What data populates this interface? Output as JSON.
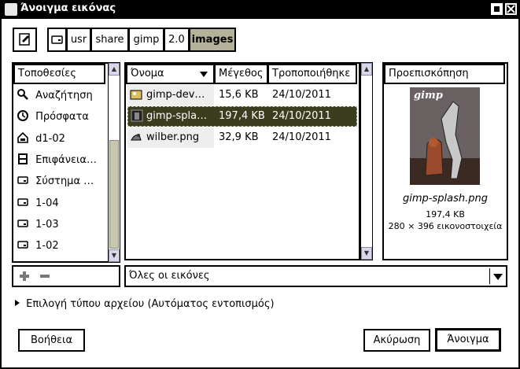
{
  "window": {
    "title": "Άνοιγμα εικόνας"
  },
  "pathbar": {
    "buttons": [
      "usr",
      "share",
      "gimp",
      "2.0",
      "images"
    ],
    "active": "images"
  },
  "places": {
    "header": "Τοποθεσίες",
    "items": [
      {
        "label": "Αναζήτηση",
        "icon": "search-icon"
      },
      {
        "label": "Πρόσφατα",
        "icon": "clock-icon"
      },
      {
        "label": "d1-02",
        "icon": "home-icon"
      },
      {
        "label": "Επιφάνεια…",
        "icon": "desktop-icon"
      },
      {
        "label": "Σύστημα …",
        "icon": "drive-icon"
      },
      {
        "label": "1-04",
        "icon": "drive-icon"
      },
      {
        "label": "1-03",
        "icon": "drive-icon"
      },
      {
        "label": "1-02",
        "icon": "drive-icon"
      }
    ]
  },
  "files": {
    "columns": {
      "name": "Όνομα",
      "size": "Μέγεθος",
      "modified": "Τροποποιήθηκε"
    },
    "rows": [
      {
        "name": "gimp-dev…",
        "size": "15,6 KB",
        "modified": "24/10/2011",
        "selected": false
      },
      {
        "name": "gimp-spla…",
        "size": "197,4 KB",
        "modified": "24/10/2011",
        "selected": true
      },
      {
        "name": "wilber.png",
        "size": "32,9 KB",
        "modified": "24/10/2011",
        "selected": false
      }
    ]
  },
  "preview": {
    "header": "Προεπισκόπηση",
    "logo_text": "gimp",
    "filename": "gimp-splash.png",
    "size": "197,4 KB",
    "dimensions": "280 × 396 εικονοστοιχεία"
  },
  "filter": {
    "value": "Όλες οι εικόνες"
  },
  "filetype_expander": "Επιλογή τύπου αρχείου (Αυτόματος εντοπισμός)",
  "buttons": {
    "help": "Βοήθεια",
    "cancel": "Ακύρωση",
    "open": "Άνοιγμα"
  },
  "colors": {
    "selection": "#3c3c1e",
    "active_path": "#b4b29a",
    "scroll_thumb": "#c8c6ae"
  }
}
